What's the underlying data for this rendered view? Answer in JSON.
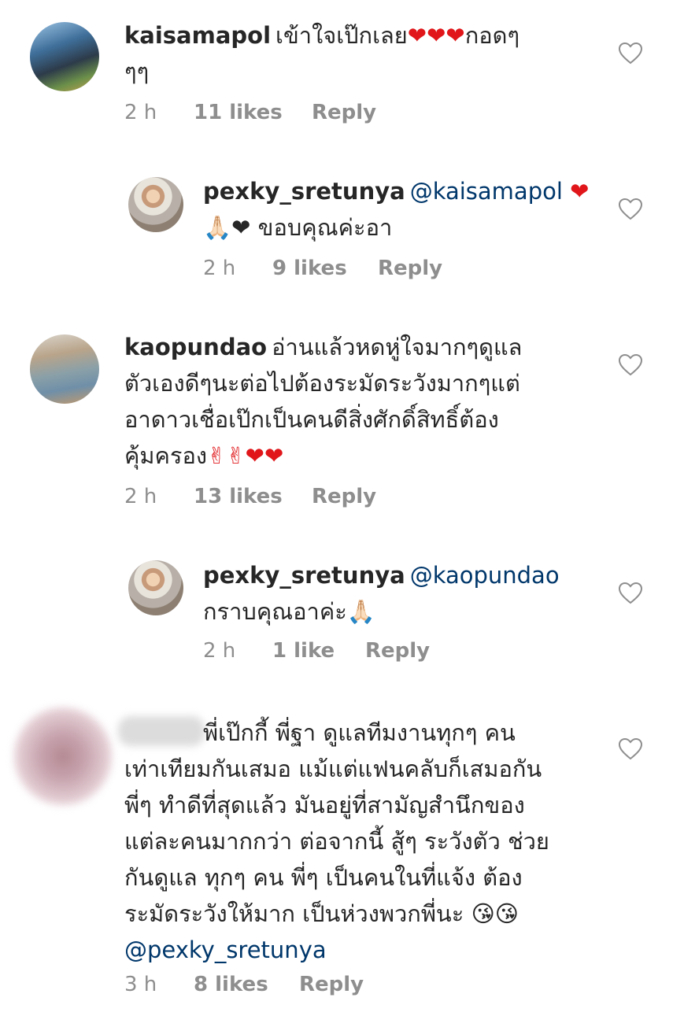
{
  "comments": [
    {
      "username": "kaisamapol",
      "text": "เข้าใจเป๊กเลย",
      "emoji": "❤❤❤",
      "text_after": "กอดๆ",
      "text_line2": "ๆๆ",
      "time": "2 h",
      "likes": "11 likes",
      "reply": "Reply",
      "avatar_icon": "profile-photo"
    },
    {
      "username": "pexky_sretunya",
      "mention": "@kaisamapol",
      "emoji_end": "❤",
      "line2_emoji": "🙏🏻❤",
      "text_line2": "ขอบคุณค่ะอา",
      "time": "2 h",
      "likes": "9 likes",
      "reply": "Reply"
    },
    {
      "username": "kaopundao",
      "line1": "อ่านแล้วหดหู่ใจมากๆดูแล",
      "line2": "ตัวเองดีๆนะต่อไปต้องระมัดระวังมากๆแต่",
      "line3": "อาดาวเชื่อเป๊กเป็นคนดีสิ่งศักดิ์สิทธิ์ต้อง",
      "line4": "คุ้มครอง",
      "emoji": "✌✌❤❤",
      "time": "2 h",
      "likes": "13 likes",
      "reply": "Reply"
    },
    {
      "username": "pexky_sretunya",
      "mention": "@kaopundao",
      "text_line2": "กราบคุณอาค่ะ",
      "emoji": "🙏🏻",
      "time": "2 h",
      "likes": "1 like",
      "reply": "Reply"
    },
    {
      "line1": "พี่เป๊กกี้ พี่ฐา ดูแลทีมงานทุกๆ คน",
      "line2": "เท่าเทียมกันเสมอ แม้แต่แฟนคลับก็เสมอกัน",
      "line3": "พี่ๆ ทำดีที่สุดแล้ว มันอยู่ที่สามัญสำนึกของ",
      "line4": "แต่ละคนมากกว่า ต่อจากนี้ สู้ๆ ระวังตัว ช่วย",
      "line5": "กันดูแล ทุกๆ คน พี่ๆ เป็นคนในที่แจ้ง ต้อง",
      "line6": "ระมัดระวังให้มาก เป็นห่วงพวกพี่นะ",
      "emoji": "😘😘",
      "mention": "@pexky_sretunya",
      "time": "3 h",
      "likes": "8 likes",
      "reply": "Reply"
    }
  ]
}
